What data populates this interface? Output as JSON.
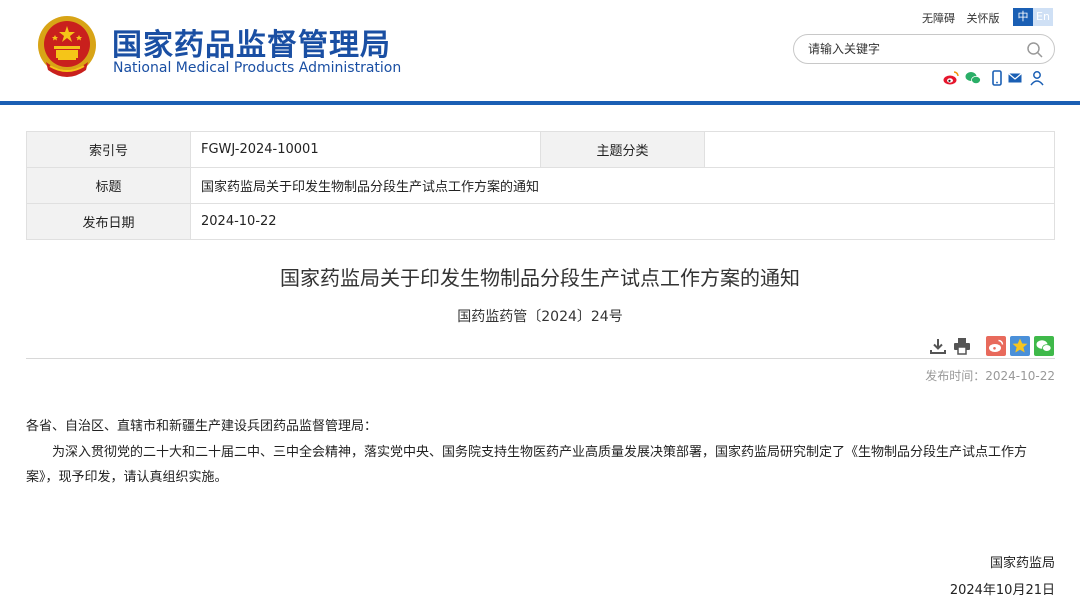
{
  "header": {
    "org_name_cn": "国家药品监督管理局",
    "org_name_en": "National Medical Products Administration",
    "accessibility_link": "无障碍",
    "elderly_link": "关怀版",
    "lang_zh": "中",
    "lang_en": "En",
    "search_placeholder": "请输入关键字",
    "social_icons": [
      "weibo-icon",
      "wechat-icon",
      "mobile-icon",
      "mail-icon",
      "user-icon"
    ],
    "accent_color": "#1a5fb4"
  },
  "meta": {
    "index_label": "索引号",
    "index_value": "FGWJ-2024-10001",
    "category_label": "主题分类",
    "category_value": "",
    "title_label": "标题",
    "title_value": "国家药监局关于印发生物制品分段生产试点工作方案的通知",
    "date_label": "发布日期",
    "date_value": "2024-10-22"
  },
  "article": {
    "title": "国家药监局关于印发生物制品分段生产试点工作方案的通知",
    "doc_number": "国药监药管〔2024〕24号",
    "tool_icons": [
      "download-icon",
      "print-icon",
      "share-weibo-icon",
      "share-qzone-icon",
      "share-wechat-icon"
    ],
    "publish_time": "发布时间：2024-10-22",
    "salutation": "各省、自治区、直辖市和新疆生产建设兵团药品监督管理局：",
    "body": "为深入贯彻党的二十大和二十届二中、三中全会精神，落实党中央、国务院支持生物医药产业高质量发展决策部署，国家药监局研究制定了《生物制品分段生产试点工作方案》，现予印发，请认真组织实施。",
    "signature_org": "国家药监局",
    "signature_date": "2024年10月21日"
  }
}
